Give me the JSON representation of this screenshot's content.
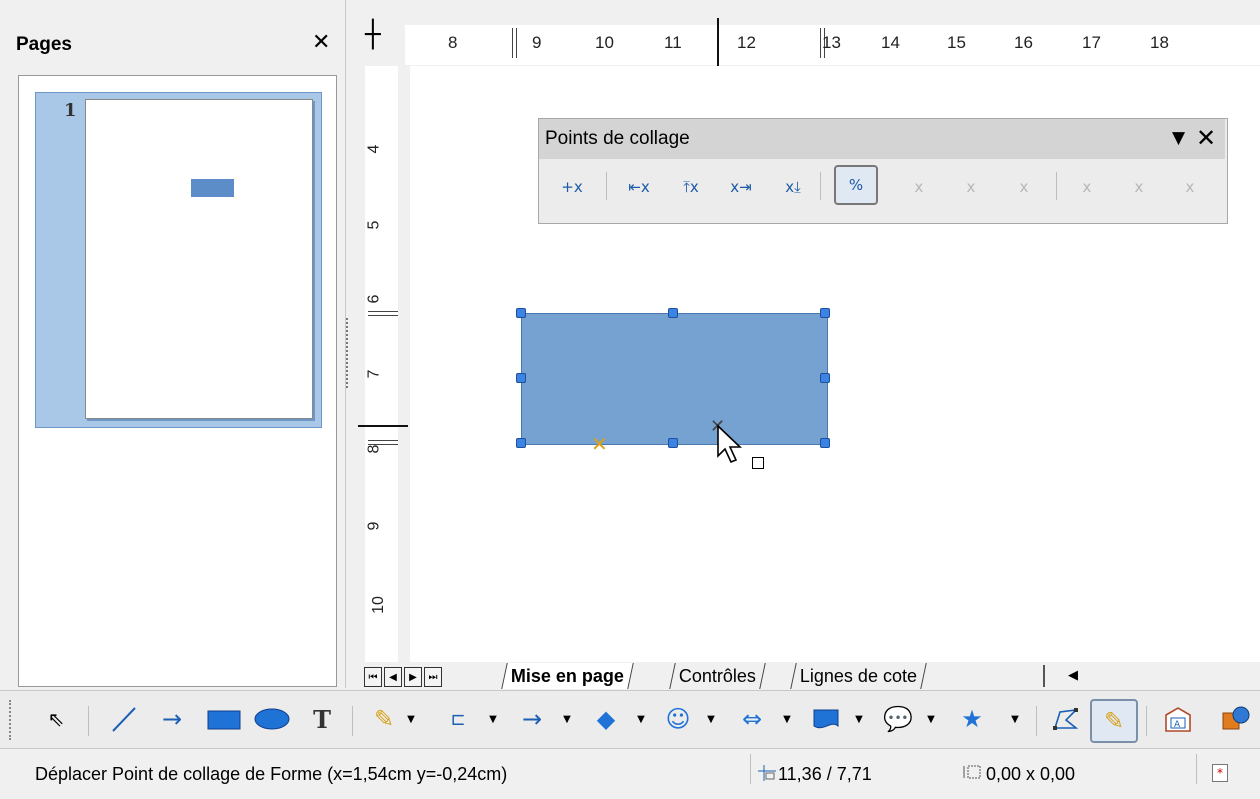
{
  "colors": {
    "accent": "#3b84e4",
    "shape_fill": "#76a2d2",
    "selection": "#a9c8e8"
  },
  "pages_pane": {
    "title": "Pages",
    "close_icon": "close-icon",
    "thumbnail_number": "1"
  },
  "ruler": {
    "h_ticks": [
      "8",
      "9",
      "10",
      "11",
      "12",
      "13",
      "14",
      "15",
      "16",
      "17",
      "18"
    ],
    "v_ticks": [
      "4",
      "5",
      "6",
      "7",
      "8",
      "9",
      "10"
    ]
  },
  "gluepoints_toolbar": {
    "title": "Points de collage",
    "menu_icon": "dropdown-arrow-icon",
    "close_icon": "close-icon",
    "buttons": [
      {
        "name": "insert-glue-point",
        "label": "+x",
        "enabled": true
      },
      {
        "name": "exit-direction-left",
        "label": "⇤x",
        "enabled": true
      },
      {
        "name": "exit-direction-top",
        "label": "⤒x",
        "enabled": true
      },
      {
        "name": "exit-direction-right",
        "label": "x⇥",
        "enabled": true
      },
      {
        "name": "exit-direction-bottom",
        "label": "x⤓",
        "enabled": true
      },
      {
        "name": "glue-point-relative",
        "label": "%",
        "enabled": true,
        "pressed": true
      },
      {
        "name": "glue-point-horizontal-left",
        "label": "x",
        "enabled": false
      },
      {
        "name": "glue-point-horizontal-center",
        "label": "x",
        "enabled": false
      },
      {
        "name": "glue-point-horizontal-right",
        "label": "x",
        "enabled": false
      },
      {
        "name": "glue-point-vertical-top",
        "label": "x",
        "enabled": false
      },
      {
        "name": "glue-point-vertical-center",
        "label": "x",
        "enabled": false
      },
      {
        "name": "glue-point-vertical-bottom",
        "label": "x",
        "enabled": false
      }
    ]
  },
  "tabs": [
    {
      "label": "Mise en page",
      "active": true
    },
    {
      "label": "Contrôles",
      "active": false
    },
    {
      "label": "Lignes de cote",
      "active": false
    }
  ],
  "drawing_toolbar": {
    "tools": [
      "select",
      "line",
      "arrow",
      "rectangle",
      "ellipse",
      "text",
      "curve",
      "connector",
      "lines-arrows",
      "basic-shapes",
      "symbol-shapes",
      "block-arrows",
      "flowchart",
      "callouts",
      "stars",
      "points",
      "glue-points",
      "fontwork",
      "3d-objects"
    ]
  },
  "statusbar": {
    "message": "Déplacer Point de collage de Forme (x=1,54cm y=-0,24cm)",
    "position": "11,36 / 7,71",
    "size": "0,00 x 0,00"
  }
}
